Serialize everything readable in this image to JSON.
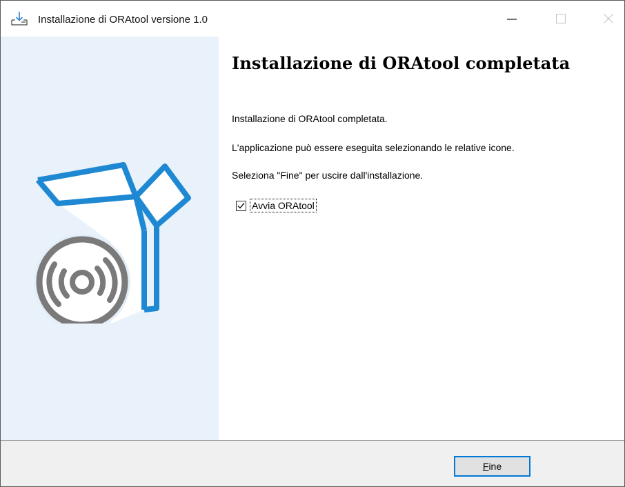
{
  "window": {
    "title": "Installazione di ORAtool versione 1.0",
    "controls": {
      "minimize_icon": "minimize-icon",
      "maximize_icon": "maximize-icon",
      "close_icon": "close-icon"
    }
  },
  "content": {
    "heading": "Installazione di ORAtool completata",
    "paragraphs": [
      "Installazione di ORAtool completata.",
      "L'applicazione può essere eseguita selezionando le relative icone.",
      "Seleziona \"Fine\" per uscire dall'installazione."
    ],
    "launch_checkbox": {
      "label": "Avvia ORAtool",
      "checked": true
    }
  },
  "footer": {
    "finish_button": {
      "mnemonic": "F",
      "rest": "ine"
    }
  },
  "colors": {
    "accent": "#0078d7",
    "left_panel": "#e9f2fa",
    "box_blue": "#1e88d2",
    "disc_gray": "#7a7a7a",
    "footer_bg": "#f0f0f0"
  },
  "icons": [
    "installer-download-icon",
    "software-box-illustration",
    "disc-icon",
    "checkmark-icon"
  ]
}
